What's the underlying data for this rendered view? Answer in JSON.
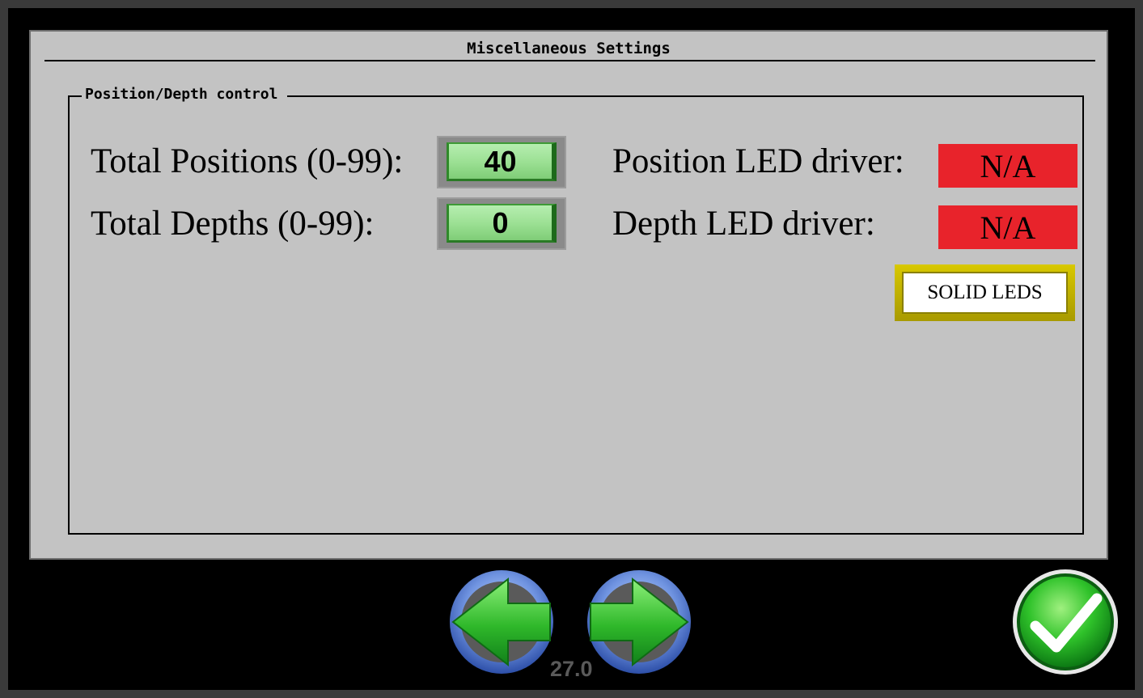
{
  "screen": {
    "title": "Miscellaneous Settings",
    "version": "27.0"
  },
  "group": {
    "legend": "Position/Depth control"
  },
  "positions": {
    "label": "Total Positions (0-99):",
    "value": "40"
  },
  "depths": {
    "label": "Total Depths (0-99):",
    "value": "0"
  },
  "position_led": {
    "label": "Position LED driver:",
    "value": "N/A"
  },
  "depth_led": {
    "label": "Depth LED driver:",
    "value": "N/A"
  },
  "solid_leds": {
    "label": "SOLID LEDS"
  },
  "icons": {
    "prev": "left-arrow-icon",
    "next": "right-arrow-icon",
    "confirm": "checkmark-icon"
  },
  "colors": {
    "panel": "#c3c3c3",
    "value_box": "#9adf92",
    "status_box": "#e8232b",
    "toggle_frame": "#c8b800"
  }
}
